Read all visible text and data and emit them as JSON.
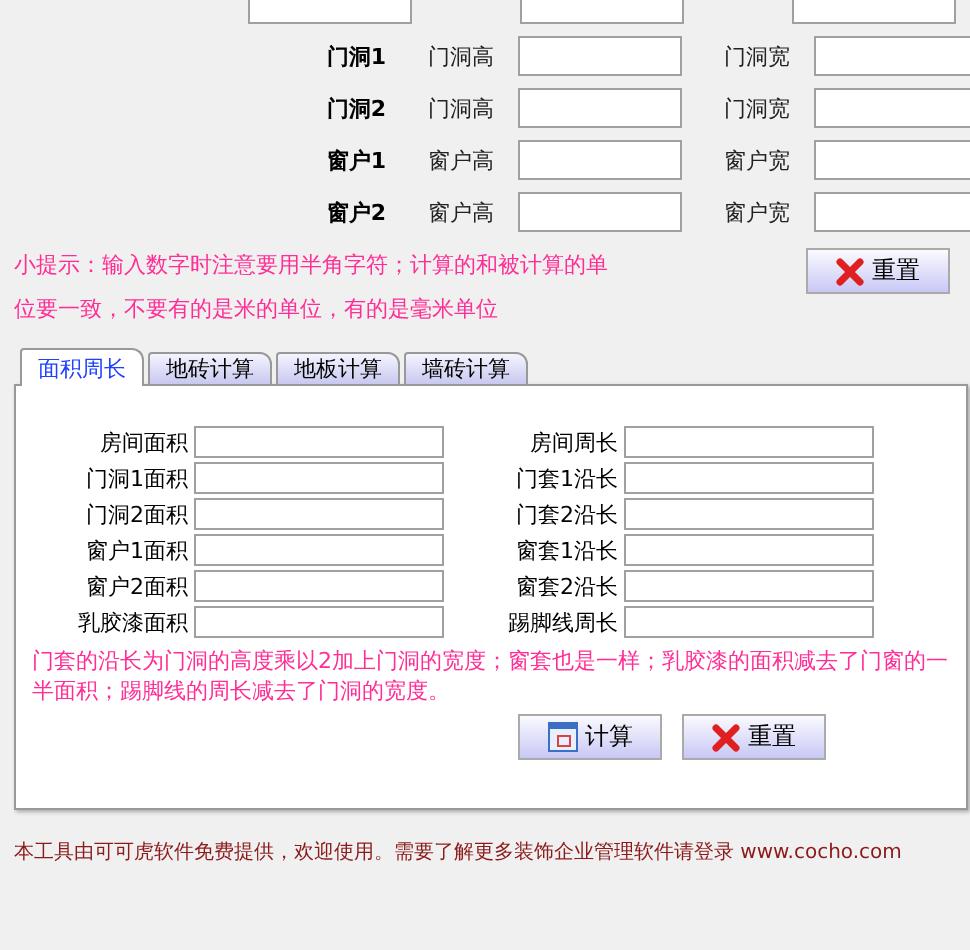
{
  "dimension_rows": [
    {
      "label": "门洞1",
      "fields": [
        {
          "label": "门洞高"
        },
        {
          "label": "门洞宽"
        }
      ]
    },
    {
      "label": "门洞2",
      "fields": [
        {
          "label": "门洞高"
        },
        {
          "label": "门洞宽"
        }
      ]
    },
    {
      "label": "窗户1",
      "fields": [
        {
          "label": "窗户高"
        },
        {
          "label": "窗户宽"
        }
      ]
    },
    {
      "label": "窗户2",
      "fields": [
        {
          "label": "窗户高"
        },
        {
          "label": "窗户宽"
        }
      ]
    }
  ],
  "hint": "小提示：输入数字时注意要用半角字符；计算的和被计算的单位要一致，不要有的是米的单位，有的是毫米单位",
  "top_reset_button": "重置",
  "tabs": [
    {
      "label": "面积周长",
      "selected": true
    },
    {
      "label": "地砖计算",
      "selected": false
    },
    {
      "label": "地板计算",
      "selected": false
    },
    {
      "label": "墙砖计算",
      "selected": false
    }
  ],
  "results_left": [
    {
      "label": "房间面积"
    },
    {
      "label": "门洞1面积"
    },
    {
      "label": "门洞2面积"
    },
    {
      "label": "窗户1面积"
    },
    {
      "label": "窗户2面积"
    },
    {
      "label": "乳胶漆面积"
    }
  ],
  "results_right": [
    {
      "label": "房间周长"
    },
    {
      "label": "门套1沿长"
    },
    {
      "label": "门套2沿长"
    },
    {
      "label": "窗套1沿长"
    },
    {
      "label": "窗套2沿长"
    },
    {
      "label": "踢脚线周长"
    }
  ],
  "note": "门套的沿长为门洞的高度乘以2加上门洞的宽度；窗套也是一样；乳胶漆的面积减去了门窗的一半面积；踢脚线的周长减去了门洞的宽度。",
  "buttons": [
    {
      "kind": "calc",
      "label": "计算"
    },
    {
      "kind": "reset",
      "label": "重置"
    }
  ],
  "footer": "本工具由可可虎软件免费提供，欢迎使用。需要了解更多装饰企业管理软件请登录 www.cocho.com"
}
